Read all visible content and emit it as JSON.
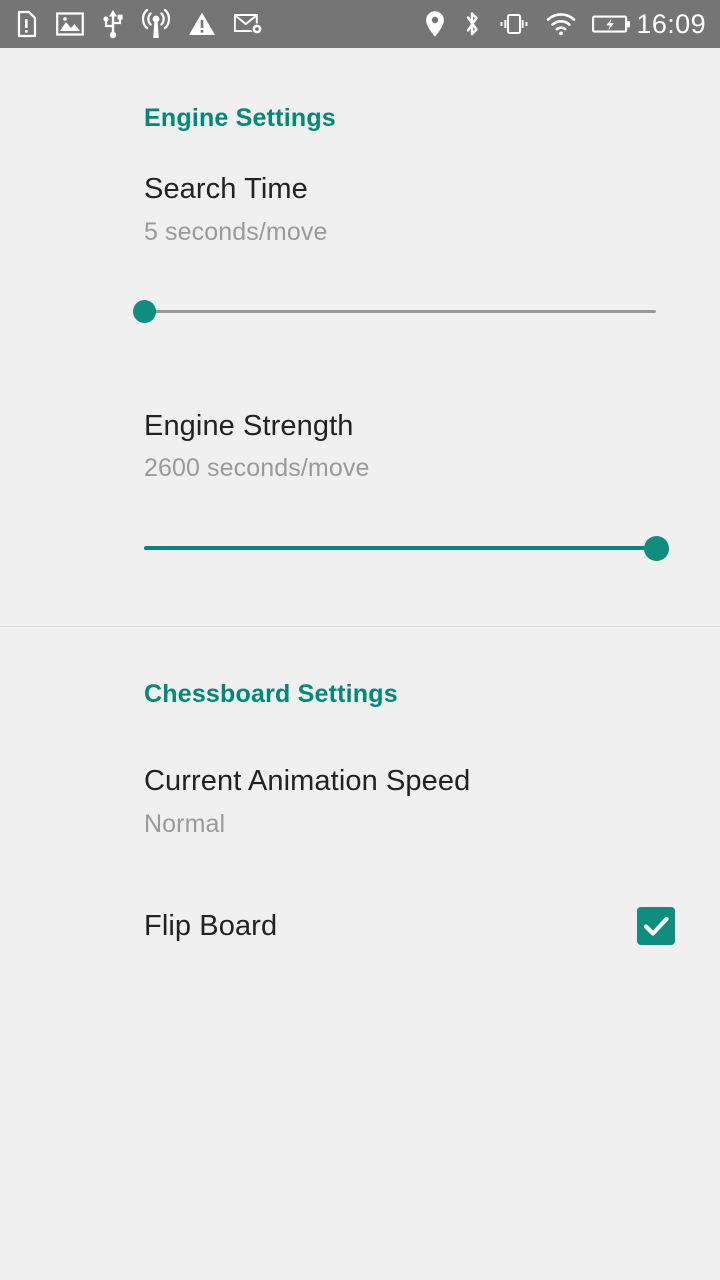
{
  "status_bar": {
    "background": "#757575",
    "foreground": "#ffffff",
    "time": "16:09",
    "left_icons": [
      {
        "name": "sim-card-alert-icon",
        "label": "SIM card alert"
      },
      {
        "name": "image-icon",
        "label": "Screenshot / image saved"
      },
      {
        "name": "usb-icon",
        "label": "USB connected"
      },
      {
        "name": "broadcast-icon",
        "label": "Broadcast / hotspot"
      },
      {
        "name": "warning-icon",
        "label": "Warning"
      },
      {
        "name": "email-settings-icon",
        "label": "Email account setup"
      }
    ],
    "right_icons": [
      {
        "name": "location-pin-icon",
        "label": "Location on"
      },
      {
        "name": "bluetooth-icon",
        "label": "Bluetooth on"
      },
      {
        "name": "vibrate-icon",
        "label": "Ringer vibrate"
      },
      {
        "name": "wifi-icon",
        "label": "Wi-Fi connected"
      },
      {
        "name": "battery-charging-icon",
        "label": "Battery charging"
      }
    ]
  },
  "theme": {
    "background": "#f0f0f0",
    "accent": "#00897b",
    "slider_accent": "#0f8e7f",
    "title_color": "#222222",
    "subtitle_color": "#9a9a9a",
    "divider_color": "#dcdcdc"
  },
  "sections": [
    {
      "id": "engine",
      "title": "Engine Settings",
      "rows": [
        {
          "id": "search-time",
          "title": "Search Time",
          "value": "5 seconds/move",
          "control": "slider",
          "slider_position_percent": 0
        },
        {
          "id": "engine-strength",
          "title": "Engine Strength",
          "value": "2600 seconds/move",
          "control": "slider",
          "slider_position_percent": 100
        }
      ]
    },
    {
      "id": "chessboard",
      "title": "Chessboard Settings",
      "rows": [
        {
          "id": "animation-speed",
          "title": "Current Animation Speed",
          "value": "Normal",
          "control": "none"
        },
        {
          "id": "flip-board",
          "title": "Flip Board",
          "value": "",
          "control": "checkbox",
          "checked": true
        }
      ]
    }
  ]
}
